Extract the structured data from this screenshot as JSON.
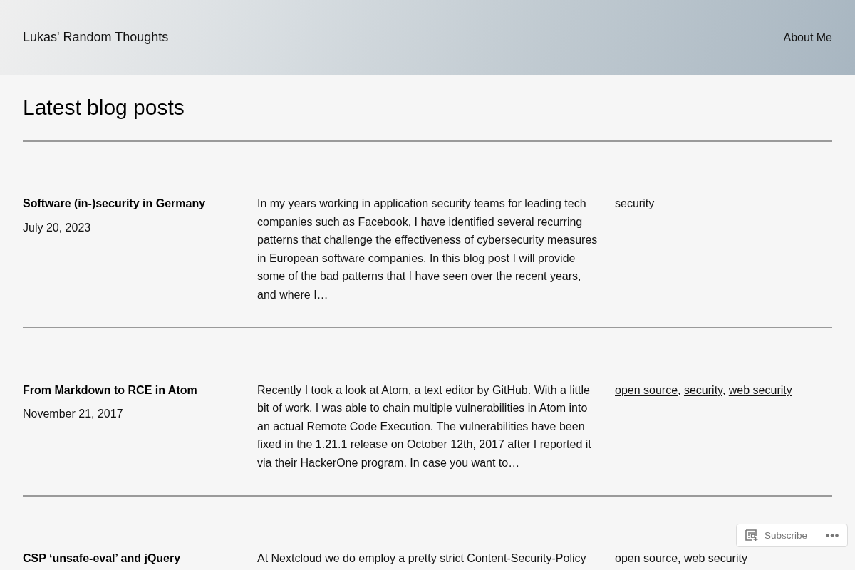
{
  "header": {
    "site_title": "Lukas' Random Thoughts",
    "nav": [
      "About Me"
    ]
  },
  "heading": "Latest blog posts",
  "tag_separator": ", ",
  "posts": [
    {
      "title": "Software (in-)security in Germany",
      "date": "July 20, 2023",
      "excerpt": "In my years working in application security teams for leading tech companies such as Facebook, I have identified several recurring patterns that challenge the effectiveness of cybersecurity measures in European software companies. In this blog post I will provide some of the bad patterns that I have seen over the recent years, and where I…",
      "tags": [
        "security"
      ]
    },
    {
      "title": "From Markdown to RCE in Atom",
      "date": "November 21, 2017",
      "excerpt": "Recently I took a look at Atom, a text editor by GitHub. With a little bit of work, I was able to chain multiple vulnerabilities in Atom into an actual Remote Code Execution. The vulnerabilities have been fixed in the 1.21.1 release on October 12th, 2017 after I reported it via their HackerOne program. In case you want to…",
      "tags": [
        "open source",
        "security",
        "web security"
      ]
    },
    {
      "title": "CSP ‘unsafe-eval’ and jQuery",
      "excerpt": "At Nextcloud we do employ a pretty strict Content-Security-Policy",
      "tags": [
        "open source",
        "web security"
      ]
    }
  ],
  "subscribe_bar": {
    "label": "Subscribe"
  }
}
